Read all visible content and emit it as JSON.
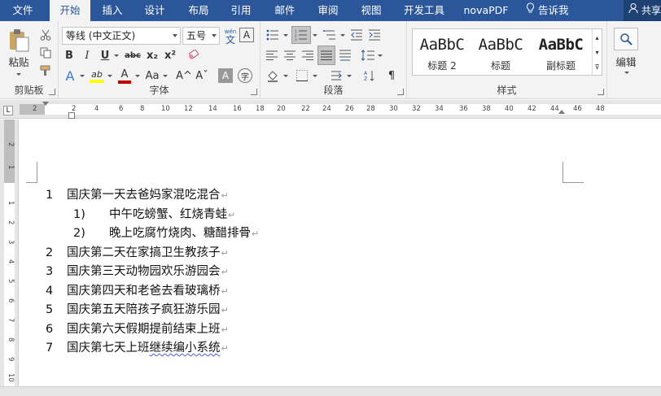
{
  "tabs": [
    "文件",
    "开始",
    "插入",
    "设计",
    "布局",
    "引用",
    "邮件",
    "审阅",
    "视图",
    "开发工具",
    "novaPDF"
  ],
  "tell_me": "告诉我",
  "share": "共享",
  "clipboard": {
    "paste": "粘贴",
    "label": "剪贴板"
  },
  "font": {
    "name": "等线 (中文正文)",
    "size": "五号",
    "wen_label": "wén",
    "wen_char": "文",
    "label": "字体",
    "btn_bold": "B",
    "btn_italic": "I",
    "btn_underline": "U",
    "btn_strike": "abc",
    "btn_sub": "x₂",
    "btn_sup": "x²",
    "btn_effects": "A",
    "btn_highlight": "ab",
    "btn_color": "A",
    "btn_case": "Aa",
    "btn_grow": "A^",
    "btn_shrink": "Aˇ",
    "btn_shade": "A",
    "btn_enclose": "字",
    "btn_border_char": "A"
  },
  "paragraph": {
    "label": "段落"
  },
  "styles": {
    "label": "样式",
    "items": [
      {
        "preview": "AaBbC",
        "name": "标题 2"
      },
      {
        "preview": "AaBbC",
        "name": "标题"
      },
      {
        "preview": "AaBbC",
        "name": "副标题"
      }
    ]
  },
  "editing": {
    "label": "编辑"
  },
  "ruler": {
    "h_numbers": [
      "2",
      "2",
      "4",
      "6",
      "8",
      "10",
      "12",
      "14",
      "16",
      "18",
      "20",
      "22",
      "24",
      "26",
      "28",
      "30",
      "32",
      "34",
      "36",
      "38",
      "40",
      "42",
      "44",
      "46",
      "48"
    ],
    "v_numbers": [
      "2",
      "1",
      "1",
      "2",
      "3",
      "4",
      "5",
      "6",
      "7",
      "8",
      "9",
      "10"
    ]
  },
  "document": {
    "lines": [
      {
        "num": "1",
        "text": "国庆第一天去爸妈家混吃混合"
      },
      {
        "num": "1)",
        "text": "中午吃螃蟹、红烧青蛙"
      },
      {
        "num": "2)",
        "text": "晚上吃腐竹烧肉、糖醋排骨"
      },
      {
        "num": "2",
        "text": "国庆第二天在家搞卫生教孩子"
      },
      {
        "num": "3",
        "text": "国庆第三天动物园欢乐游园会"
      },
      {
        "num": "4",
        "text": "国庆第四天和老爸去看玻璃桥"
      },
      {
        "num": "5",
        "text": "国庆第五天陪孩子疯狂游乐园"
      },
      {
        "num": "6",
        "text": "国庆第六天假期提前结束上班"
      },
      {
        "num": "7",
        "text": "国庆第七天上班",
        "squiggly": "继续编小系统"
      }
    ],
    "para_mark": "↵"
  }
}
